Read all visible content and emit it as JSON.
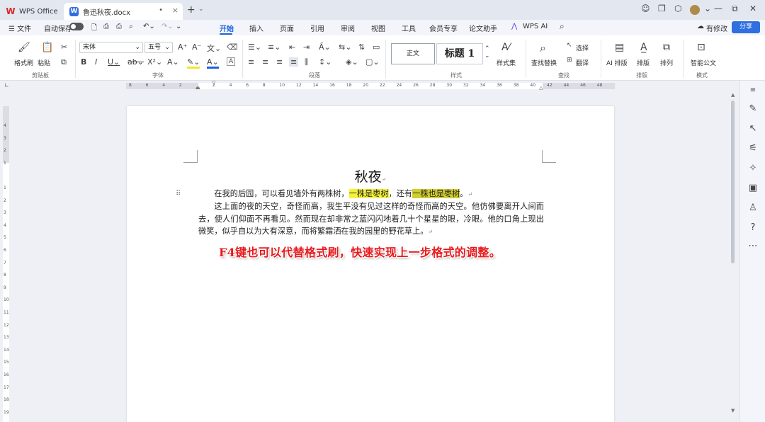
{
  "titlebar": {
    "app_tab": "WPS Office",
    "doc_tab": "鲁迅秋夜.docx",
    "doc_tab_dot": "•",
    "close": "×",
    "new_tab": "+",
    "new_tab_arrow": "⌄"
  },
  "menubar": {
    "file": "☰ 文件",
    "autosave": "自动保存",
    "tabs": [
      "开始",
      "插入",
      "页面",
      "引用",
      "审阅",
      "视图",
      "工具",
      "会员专享",
      "论文助手",
      "WPS AI"
    ],
    "active_tab": "开始",
    "revise": "有修改",
    "share": "分享"
  },
  "ribbon": {
    "clipboard": {
      "format_painter": "格式刷",
      "paste": "粘贴",
      "label": "剪贴板"
    },
    "font": {
      "family": "宋体",
      "size": "五号",
      "label": "字体"
    },
    "paragraph": {
      "label": "段落"
    },
    "styles": {
      "normal": "正文",
      "heading1": "标题 1",
      "style_set": "样式集",
      "label": "样式"
    },
    "find": {
      "find_replace": "查找替换",
      "select": "选择",
      "translate": "翻译",
      "label": "查找"
    },
    "layout": {
      "ai_layout": "AI 排版",
      "layout": "排版",
      "arrange": "排列",
      "label": "排版"
    },
    "template": {
      "smart_doc": "智能公文",
      "label": "模式"
    }
  },
  "ruler": {
    "numbers": [
      "8",
      "6",
      "4",
      "2",
      "",
      "2",
      "4",
      "6",
      "8",
      "10",
      "12",
      "14",
      "16",
      "18",
      "20",
      "22",
      "24",
      "26",
      "28",
      "30",
      "32",
      "34",
      "36",
      "38",
      "40",
      "42",
      "44",
      "46",
      "48"
    ]
  },
  "vruler": {
    "numbers": [
      "4",
      "3",
      "2",
      "1",
      "",
      "1",
      "2",
      "3",
      "4",
      "5",
      "6",
      "7",
      "8",
      "9",
      "10",
      "11",
      "12",
      "13",
      "14",
      "15",
      "16",
      "17",
      "18",
      "19",
      "20"
    ]
  },
  "document": {
    "title": "秋夜",
    "p1_pre": "在我的后园，可以看见墙外有两株树，",
    "p1_hl1": "一株是枣树",
    "p1_mid": "，还有",
    "p1_hl2": "一株也是枣树",
    "p1_post": "。",
    "p2": "这上面的夜的天空，奇怪而高，我生平没有见过这样的奇怪而高的天空。他仿佛要离开人间而去，使人们仰面不再看见。然而现在却非常之蓝闪闪地着几十个星星的眼，冷眼。他的口角上现出微笑，似乎自以为大有深意，而将繁霜洒在我的园里的野花草上。",
    "caption": "F4键也可以代替格式刷，快速实现上一步格式的调整。"
  },
  "colors": {
    "accent": "#1b63e0",
    "highlight": "#f5f23a",
    "caption_red": "#e8191c"
  }
}
